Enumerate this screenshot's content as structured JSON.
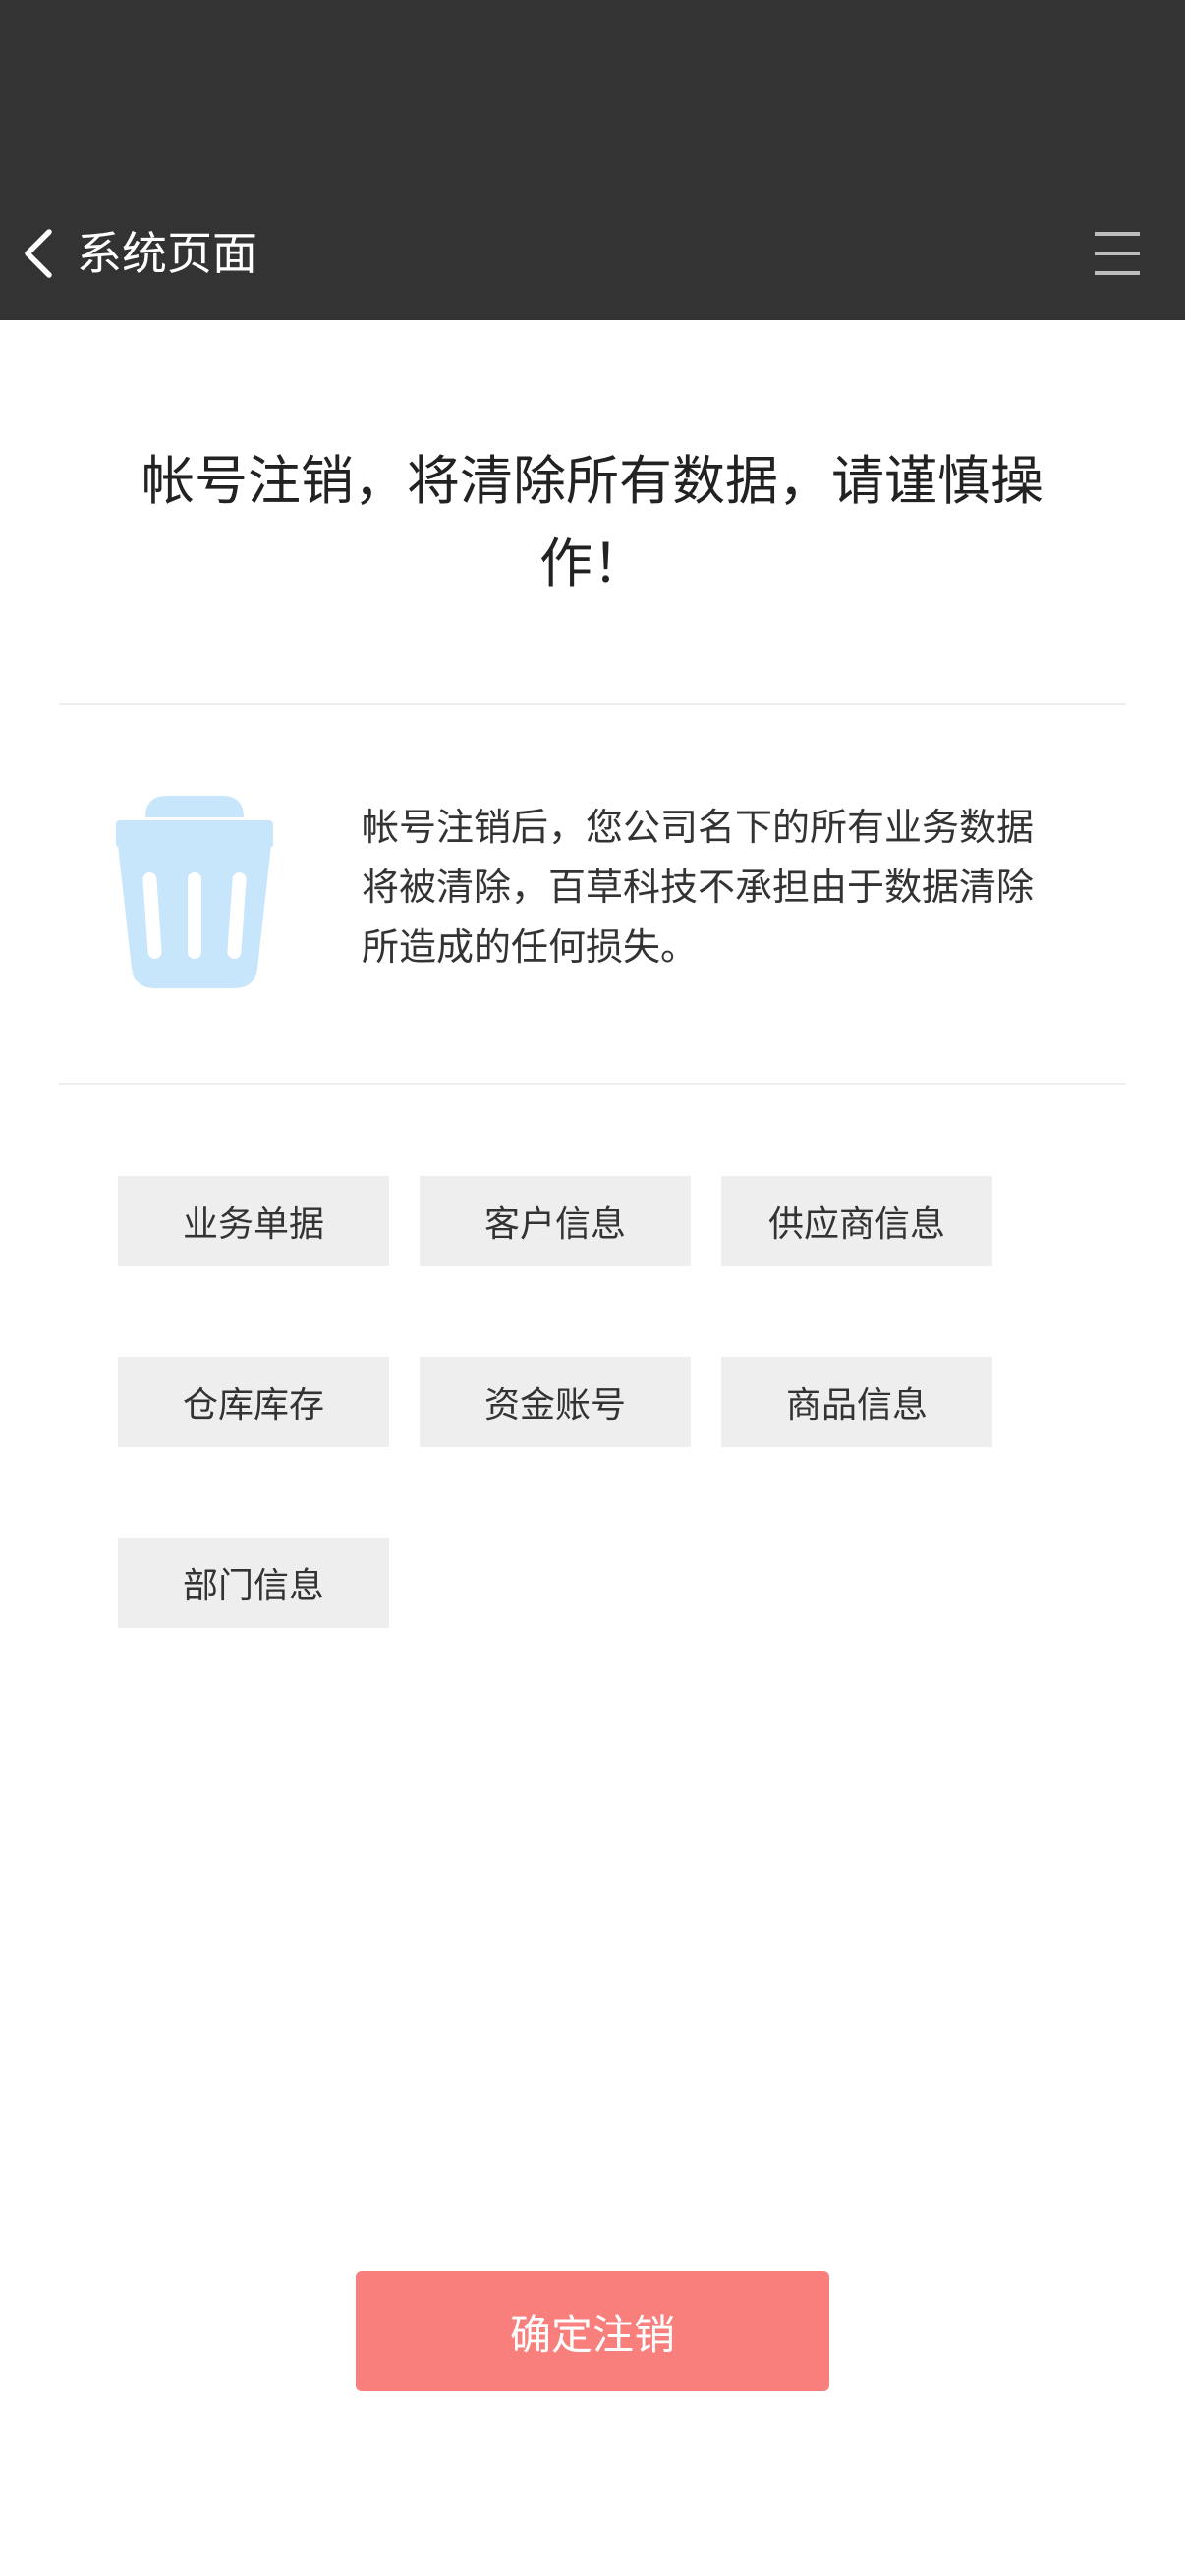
{
  "header": {
    "title": "系统页面",
    "back_icon": "chevron-left",
    "menu_icon": "hamburger-menu"
  },
  "warning": {
    "title": "帐号注销，将清除所有数据，请谨慎操作！"
  },
  "notice": {
    "icon": "trash-icon",
    "text": "帐号注销后，您公司名下的所有业务数据将被清除，百草科技不承担由于数据清除所造成的任何损失。"
  },
  "data_types": [
    "业务单据",
    "客户信息",
    "供应商信息",
    "仓库库存",
    "资金账号",
    "商品信息",
    "部门信息"
  ],
  "confirm": {
    "label": "确定注销"
  },
  "colors": {
    "header_bg": "#333333",
    "button_bg": "#f87f7c",
    "trash_icon": "#c8e6fb",
    "tag_bg": "#eeeeee"
  }
}
